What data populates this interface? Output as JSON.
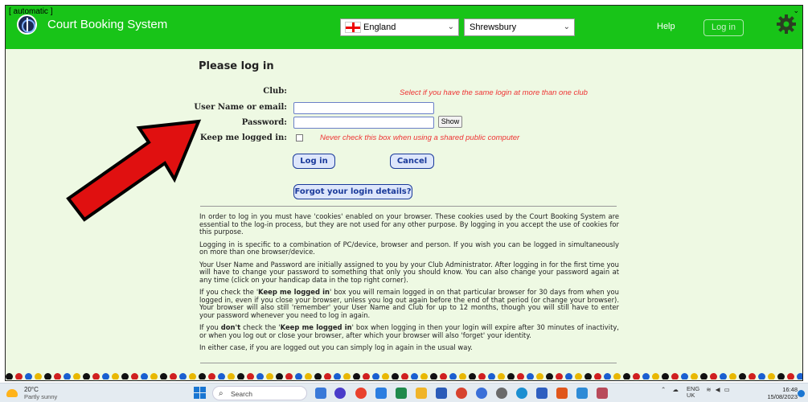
{
  "header": {
    "app_title": "Court Booking System",
    "country": "England",
    "city": "Shrewsbury",
    "help": "Help",
    "login": "Log in"
  },
  "form": {
    "title": "Please log in",
    "club_label": "Club:",
    "club_value": "[ automatic ]",
    "club_note": "Select if you have the same login at more than one club",
    "username_label": "User Name or email:",
    "username_value": "",
    "password_label": "Password:",
    "password_value": "",
    "show_label": "Show",
    "keep_label": "Keep me logged in:",
    "keep_note": "Never check this box when using a shared public computer",
    "login_button": "Log in",
    "cancel_button": "Cancel",
    "forgot_button": "Forgot your login details?"
  },
  "info": {
    "p1": "In order to log in you must have 'cookies' enabled on your browser. These cookies used by the Court Booking System are essential to the log-in process, but they are not used for any other purpose. By logging in you accept the use of cookies for this purpose.",
    "p2": "Logging in is specific to a combination of PC/device, browser and person. If you wish you can be logged in simultaneously on more than one browser/device.",
    "p3": "Your User Name and Password are initially assigned to you by your Club Administrator. After logging in for the first time you will have to change your password to something that only you should know. You can also change your password again at any time (click on your handicap data in the top right corner).",
    "p4a": "If you check the '",
    "p4b": "Keep me logged in",
    "p4c": "' box you will remain logged in on that particular browser for 30 days from when you logged in, even if you close your browser, unless you log out again before the end of that period (or change your browser). Your browser will also still 'remember' your User Name and Club for up to 12 months, though you will still have to enter your password whenever you need to log in again.",
    "p5a": "If you ",
    "p5b": "don't",
    "p5c": " check the '",
    "p5d": "Keep me logged in",
    "p5e": "' box when logging in then your login will expire after 30 minutes of inactivity, or when you log out or close your browser, after which your browser will also 'forget' your identity.",
    "p6": "In either case, if you are logged out you can simply log in again in the usual way."
  },
  "dot_colors": [
    "#111111",
    "#d02020",
    "#1a5fd0",
    "#e8b800"
  ],
  "taskbar": {
    "temperature": "20°C",
    "condition": "Partly sunny",
    "search": "Search",
    "lang": "ENG",
    "region": "UK",
    "time": "16:48",
    "date": "15/08/2023"
  },
  "colors": {
    "header_green": "#18c418",
    "page_bg": "#eef9e3",
    "arrow_red": "#e01010",
    "button_blue": "#1a3a9a",
    "note_red": "#e33333"
  }
}
